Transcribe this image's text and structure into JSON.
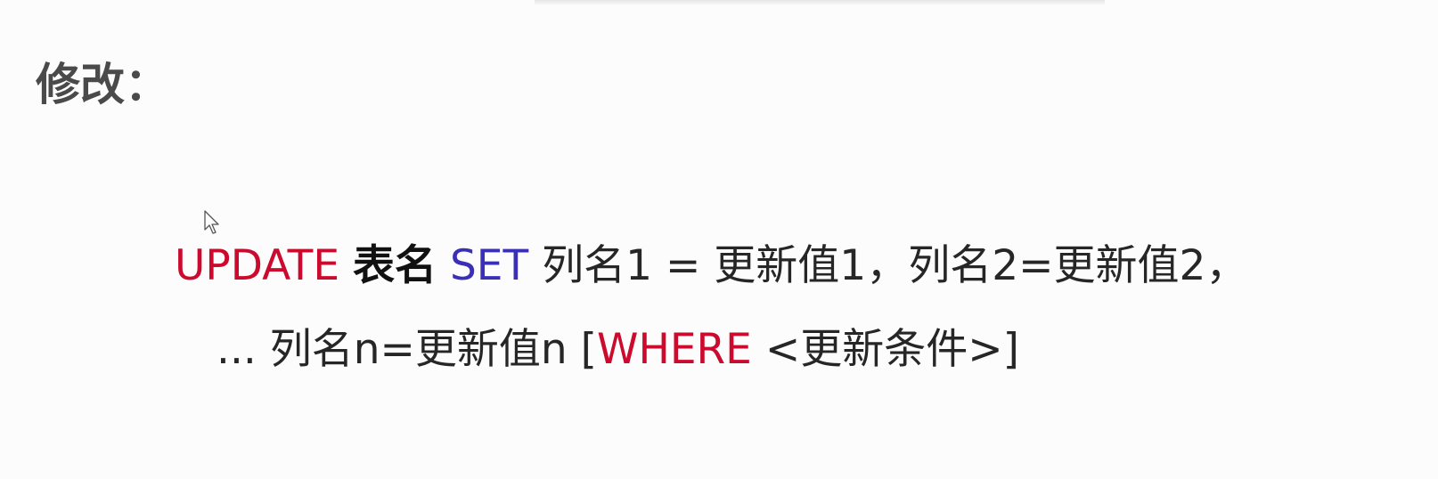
{
  "heading": "修改：",
  "statement": {
    "line1": {
      "update_kw": "UPDATE",
      "table_name": "表名",
      "set_kw": "SET",
      "assignments": "列名1 = 更新值1，列名2=更新值2，"
    },
    "line2": {
      "continuation": "... 列名n=更新值n [",
      "where_kw": "WHERE",
      "condition": "<更新条件>]"
    }
  },
  "colors": {
    "keyword_red": "#cc0a2e",
    "keyword_blue": "#3a2fb6",
    "text": "#262626",
    "heading": "#4a4a4a"
  },
  "icons": {
    "cursor": "mouse-pointer-icon"
  }
}
